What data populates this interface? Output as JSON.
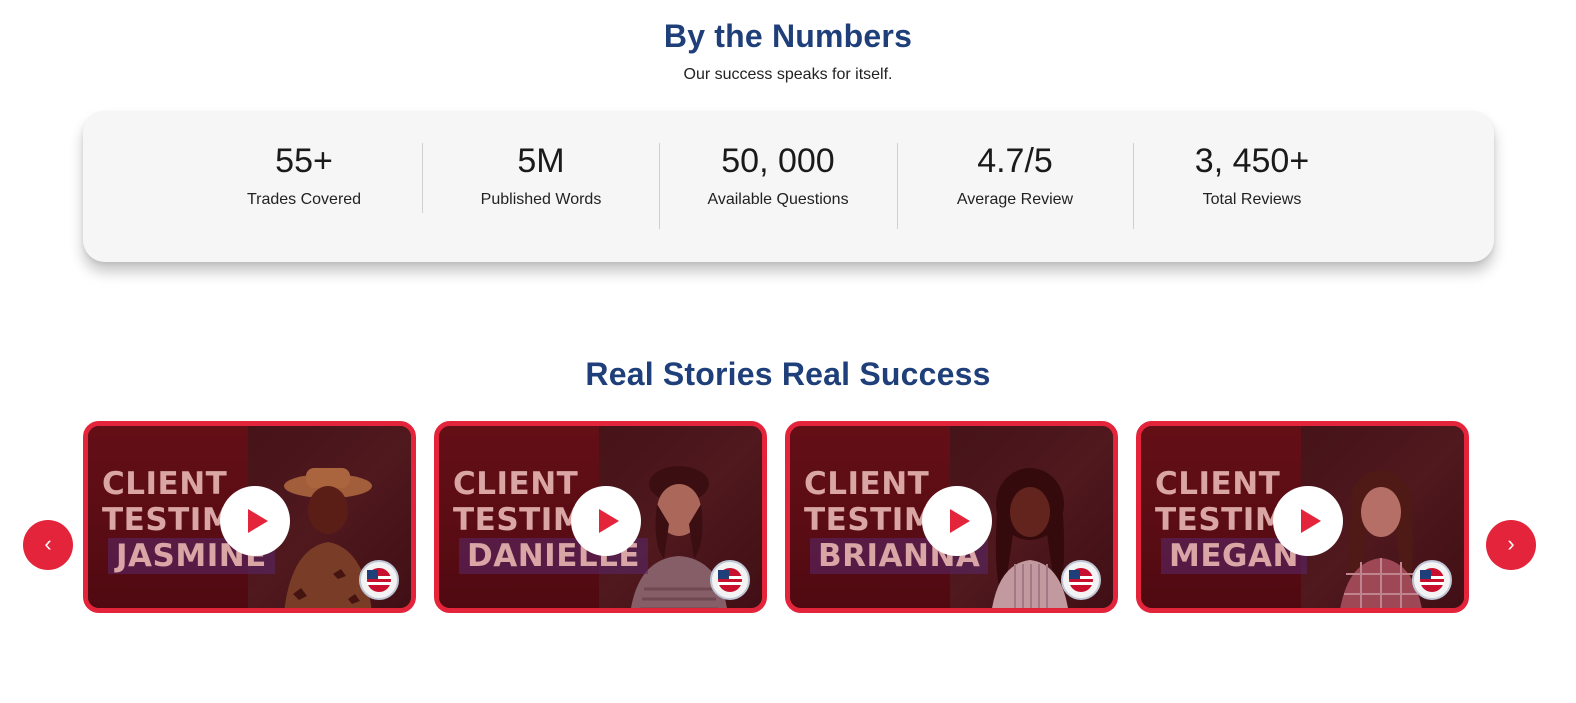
{
  "stats_section": {
    "title": "By the Numbers",
    "subtitle": "Our success speaks for itself.",
    "stats": [
      {
        "value": "55+",
        "label": "Trades Covered"
      },
      {
        "value": "5M",
        "label": "Published Words"
      },
      {
        "value": "50, 000",
        "label": "Available Questions"
      },
      {
        "value": "4.7/5",
        "label": "Average Review"
      },
      {
        "value": "3, 450+",
        "label": "Total Reviews"
      }
    ]
  },
  "stories_section": {
    "title": "Real Stories Real Success",
    "prev_label": "‹",
    "next_label": "›",
    "cards": [
      {
        "line1": "CLIENT",
        "line2": "TESTIMO",
        "name": "JASMINE"
      },
      {
        "line1": "CLIENT",
        "line2": "TESTIMO",
        "name": "DANIELLE"
      },
      {
        "line1": "CLIENT",
        "line2": "TESTIMO",
        "name": "BRIANNA"
      },
      {
        "line1": "CLIENT",
        "line2": "TESTIMO",
        "name": "MEGAN"
      }
    ]
  },
  "colors": {
    "heading": "#1f3f7a",
    "accent": "#e3243b",
    "card_bg": "#f6f6f6"
  },
  "icons": {
    "play": "play-icon",
    "prev": "chevron-left-icon",
    "next": "chevron-right-icon",
    "seal": "us-flag-seal-icon"
  }
}
